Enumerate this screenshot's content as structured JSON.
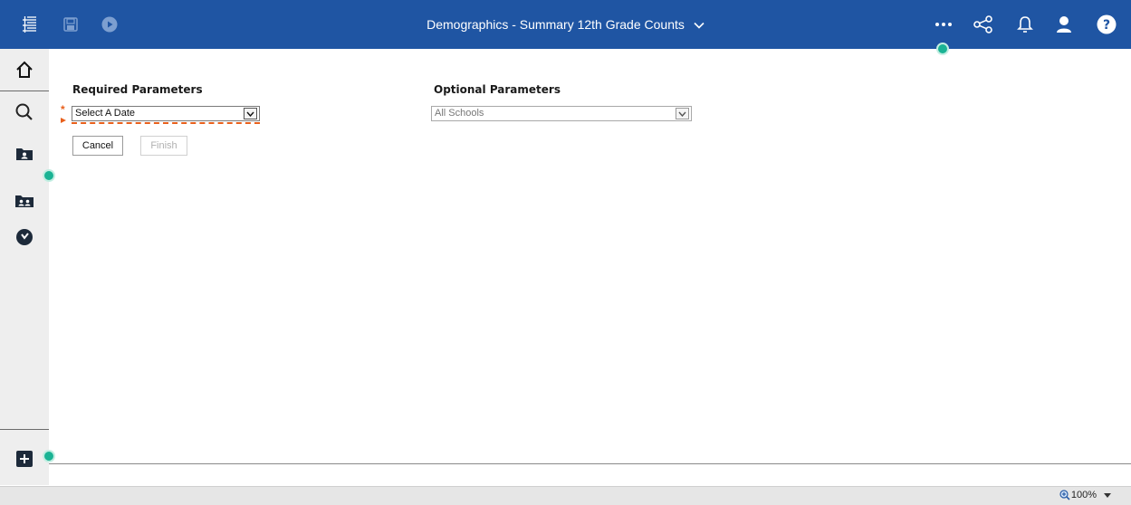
{
  "header": {
    "title": "Demographics - Summary 12th Grade Counts",
    "icons": [
      "menu-icon",
      "save-icon",
      "run-icon",
      "more-icon",
      "share-icon",
      "bell-icon",
      "user-icon",
      "help-icon"
    ],
    "help_label": "?"
  },
  "sidebar": {
    "items": [
      "home-icon",
      "search-icon",
      "my-content-icon",
      "team-content-icon",
      "recent-icon"
    ],
    "add_icon": "plus-icon"
  },
  "required": {
    "title": "Required Parameters",
    "required_marker": "*",
    "date_select_value": "Select A Date",
    "cancel_label": "Cancel",
    "finish_label": "Finish"
  },
  "optional": {
    "title": "Optional Parameters",
    "school_select_value": "All Schools"
  },
  "status": {
    "zoom_label": "100%"
  },
  "colors": {
    "topbar": "#1f55a3",
    "accent_dot": "#1ab394",
    "required_marker": "#e8601c"
  }
}
